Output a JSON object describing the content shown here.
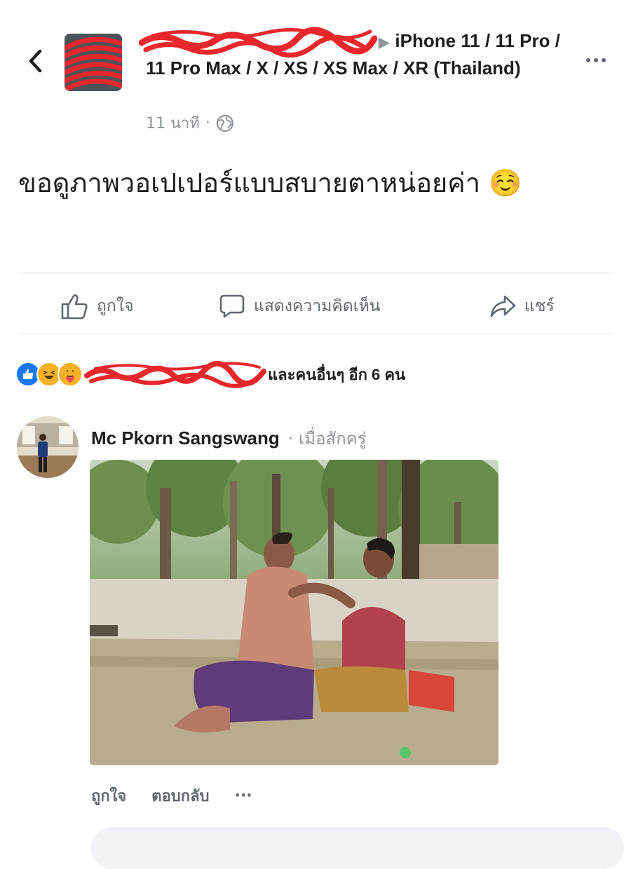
{
  "header": {
    "back_icon": "chevron-left-icon",
    "group_title": "iPhone 11 / 11 Pro / 11 Pro Max / X / XS / XS Max / XR (Thailand)",
    "arrow_glyph": "▶",
    "time": "11 นาที",
    "separator": "·",
    "privacy_icon": "globe-icon",
    "more_icon": "more-horizontal-icon"
  },
  "post": {
    "text": "ขอดูภาพวอเปเปอร์แบบสบายตาหน่อยค่า ☺️"
  },
  "actions": {
    "like": {
      "label": "ถูกใจ",
      "icon": "thumbs-up-icon"
    },
    "comment": {
      "label": "แสดงความคิดเห็น",
      "icon": "comment-bubble-icon"
    },
    "share": {
      "label": "แชร์",
      "icon": "share-arrow-icon"
    }
  },
  "reactions": {
    "summary_text": "และคนอื่นๆ อีก 6 คน",
    "icons": [
      "like-reaction-icon",
      "haha-reaction-icon",
      "care-reaction-icon"
    ],
    "colors": {
      "like": "#1877f2",
      "haha": "#f7b125",
      "redaction": "#e8262b"
    }
  },
  "comment": {
    "author": "Mc Pkorn Sangswang",
    "time": "· เมื่อสักครู่",
    "like_label": "ถูกใจ",
    "reply_label": "ตอบกลับ",
    "more_label": "···"
  },
  "colors": {
    "text_primary": "#1c1e21",
    "text_secondary": "#606770",
    "meta": "#90949c",
    "divider": "#dadde1"
  }
}
